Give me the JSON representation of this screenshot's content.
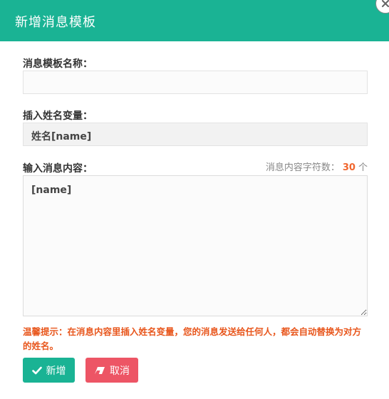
{
  "dialog": {
    "title": "新增消息模板"
  },
  "form": {
    "name_label": "消息模板名称：",
    "name_value": "",
    "var_label": "插入姓名变量：",
    "var_value": "姓名[name]",
    "content_label": "输入消息内容：",
    "counter_prefix": "消息内容字符数：",
    "counter_value": "30",
    "counter_unit": "个",
    "content_value": "[name]"
  },
  "hint": "温馨提示：在消息内容里插入姓名变量，您的消息发送给任何人，都会自动替换为对方的姓名。",
  "buttons": {
    "add_label": "新增",
    "cancel_label": "取消"
  },
  "icons": {
    "close": "close-icon",
    "add": "check-icon",
    "cancel": "eraser-icon"
  },
  "colors": {
    "primary": "#1ab394",
    "danger": "#ed5565",
    "hint": "#e8561c",
    "counter": "#f0662e"
  }
}
